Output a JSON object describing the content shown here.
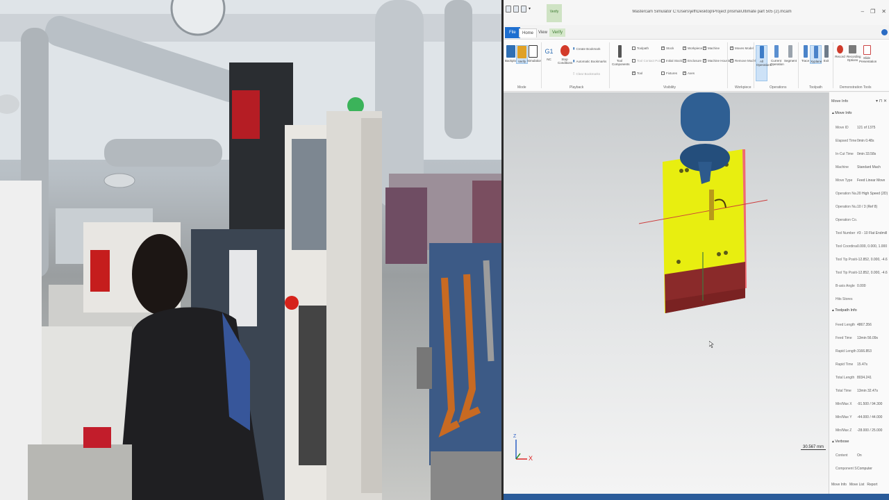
{
  "window": {
    "title": "Mastercam Simulator  C:\\Users\\jeff\\Desktop\\Project prisma\\Ultimate part 505 (2).mcam",
    "context_tab": "Verify",
    "controls": [
      "–",
      "❐",
      "✕"
    ]
  },
  "tabs": {
    "file": "File",
    "home": "Home",
    "view": "View",
    "verify": "Verify"
  },
  "ribbon": {
    "mode": {
      "buttons": [
        "Backplot",
        "Verify",
        "Simulation"
      ],
      "group": "Mode"
    },
    "playback": {
      "buttons": [
        "G1",
        "Stop Conditions"
      ],
      "nc_label": "NC",
      "options": [
        "Create Bookmark",
        "Automatic Bookmarks",
        "Clear Bookmarks"
      ],
      "group": "Playback"
    },
    "visibility": {
      "tool_components": "Tool Components",
      "options": [
        "Toolpath",
        "Tool Contact Point",
        "Tool",
        "Stock",
        "Initial Stock",
        "Fixtures",
        "Workpiece",
        "Enclosure",
        "Axes",
        "Machine",
        "Machine Housing"
      ],
      "group": "Visibility"
    },
    "workpiece": {
      "options": [
        "Moves Model",
        "Remove Model"
      ],
      "group": "Workpiece"
    },
    "operations": {
      "buttons": [
        "All Operations",
        "Current Operation",
        "Segment"
      ],
      "group": "Operations"
    },
    "toolpath": {
      "buttons": [
        "Trace",
        "Xyplane",
        "Exit"
      ],
      "group": "Toolpath"
    },
    "demonstration": {
      "buttons": [
        "Record",
        "Recording Options",
        "Slide Presentation"
      ],
      "group": "Demonstration Tools"
    }
  },
  "viewport": {
    "scale_label": "30.567 mm",
    "axis_x": "X",
    "axis_z": "Z"
  },
  "panel": {
    "title": "Move Info",
    "controls": "▾ ⊓ ✕",
    "sections": [
      {
        "name": "Move Info",
        "rows": [
          {
            "k": "Move ID",
            "v": "121 of 1375"
          },
          {
            "k": "Elapsed Time",
            "v": "0min 0.48s"
          },
          {
            "k": "In-Cut Time",
            "v": "0min 33.58s"
          },
          {
            "k": "Machine",
            "v": "Standard Mach"
          },
          {
            "k": "Move Type",
            "v": "Feed Linear Move"
          },
          {
            "k": "Operation Na..",
            "v": "20 High Speed (2D)"
          },
          {
            "k": "Operation Nu..",
            "v": "10 / 3 (Ref 8)"
          },
          {
            "k": "Operation Co..",
            "v": ""
          },
          {
            "k": "Tool Number",
            "v": "#3 - 10 Flat Endmill"
          },
          {
            "k": "Tool Coordinat..",
            "v": "0.000, 0.000, 1.000"
          },
          {
            "k": "Tool Tip Positi..",
            "v": "-12.852, 0.000, -4.67"
          },
          {
            "k": "Tool Tip Positi..",
            "v": "-12.852, 0.000, -4.67"
          },
          {
            "k": "B-axis Angle",
            "v": "0.000"
          },
          {
            "k": "Hits Stores",
            "v": ""
          }
        ]
      },
      {
        "name": "Toolpath Info",
        "rows": [
          {
            "k": "Feed Length",
            "v": "4867.356"
          },
          {
            "k": "Feed Time",
            "v": "13min 56.09s"
          },
          {
            "k": "Rapid Length",
            "v": "3166.853"
          },
          {
            "k": "Rapid Time",
            "v": "15.47s"
          },
          {
            "k": "Total Length",
            "v": "8034.241"
          },
          {
            "k": "Total Time",
            "v": "13min 32.47s"
          },
          {
            "k": "Min/Max X",
            "v": "-91.500 / 94.300"
          },
          {
            "k": "Min/Max Y",
            "v": "-44.000 / 44.000"
          },
          {
            "k": "Min/Max Z",
            "v": "-28.000 / 25.000"
          }
        ]
      },
      {
        "name": "Verbose",
        "rows": [
          {
            "k": "Content",
            "v": "On"
          },
          {
            "k": "Component S..",
            "v": "Computer"
          }
        ]
      }
    ],
    "footer_tabs": [
      "Move Info",
      "Move List",
      "Report"
    ]
  },
  "colors": {
    "file_tab": "#1e6fd0",
    "verify_accent": "#3b7a2f",
    "stock_yellow": "#e8ee10",
    "fixture_red": "#8a2a2a",
    "spindle_blue": "#2f5f93",
    "status_bar": "#2b5c9a"
  }
}
